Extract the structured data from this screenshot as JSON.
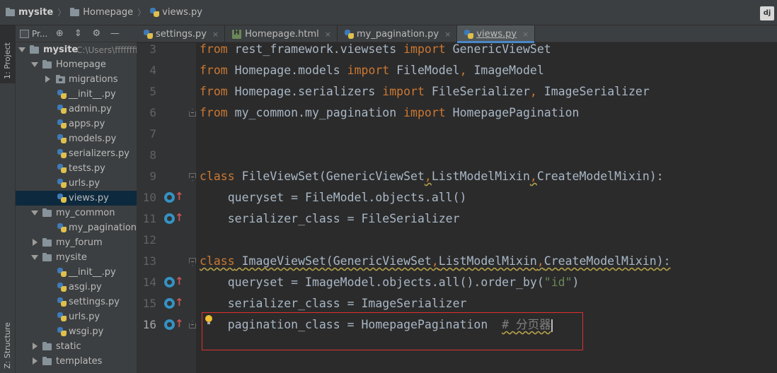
{
  "breadcrumb": {
    "project": "mysite",
    "folder": "Homepage",
    "file": "views.py"
  },
  "navbar": {
    "django_badge": "dj"
  },
  "toolstrip": {
    "project_label": "1: Project",
    "structure_label": "Z: Structure"
  },
  "panel": {
    "title": "Pr...",
    "icons": [
      "globe-icon",
      "collapse-icon",
      "gear-icon",
      "minimize-icon"
    ]
  },
  "tree": {
    "root_name": "mysite",
    "root_path": "C:\\Users\\ffffffff",
    "homepage": "Homepage",
    "migrations": "migrations",
    "homepage_files": [
      "__init__.py",
      "admin.py",
      "apps.py",
      "models.py",
      "serializers.py",
      "tests.py",
      "urls.py",
      "views.py"
    ],
    "my_common": "my_common",
    "my_common_files": [
      "my_pagination.py"
    ],
    "my_forum": "my_forum",
    "mysite": "mysite",
    "mysite_files": [
      "__init__.py",
      "asgi.py",
      "settings.py",
      "urls.py",
      "wsgi.py"
    ],
    "static": "static",
    "templates": "templates"
  },
  "tabs": [
    {
      "label": "settings.py",
      "icon": "python-icon",
      "active": false
    },
    {
      "label": "Homepage.html",
      "icon": "html-icon",
      "active": false
    },
    {
      "label": "my_pagination.py",
      "icon": "python-icon",
      "active": false
    },
    {
      "label": "views.py",
      "icon": "python-icon",
      "active": true
    }
  ],
  "tab_close": "×",
  "editor": {
    "line_numbers": [
      "3",
      "4",
      "5",
      "6",
      "7",
      "8",
      "9",
      "10",
      "11",
      "12",
      "13",
      "14",
      "15",
      "16"
    ],
    "current_line": "16",
    "lines": {
      "l3": [
        "from",
        " rest_framework.viewsets ",
        "import",
        " GenericViewSet"
      ],
      "l4": [
        "from",
        " Homepage.models ",
        "import",
        " FileModel",
        ",",
        " ImageModel"
      ],
      "l5": [
        "from",
        " Homepage.serializers ",
        "import",
        " FileSerializer",
        ",",
        " ImageSerializer"
      ],
      "l6": [
        "from",
        " my_common.my_pagination ",
        "import",
        " HomepagePagination"
      ],
      "l9": [
        "class",
        " FileViewSet(GenericViewSet",
        ",",
        "ListModelMixin",
        ",",
        "CreateModelMixin):"
      ],
      "l10": "    queryset = FileModel.objects.all()",
      "l11": "    serializer_class = FileSerializer",
      "l13": [
        "class",
        " ImageViewSet(GenericViewSet",
        ",",
        "ListModelMixin",
        ",",
        "CreateModelMixin):"
      ],
      "l14": [
        "    queryset = ImageModel.objects.all().order_by(",
        "\"id\"",
        ")"
      ],
      "l15": "    serializer_class = ImageSerializer",
      "l16": [
        "    pagination_class = HomepagePagination  ",
        "# 分页器"
      ]
    }
  },
  "colors": {
    "keyword": "#cc7832",
    "identifier": "#a9b7c6",
    "string": "#6a8759",
    "comment": "#808080",
    "highlight_box": "#e03030",
    "active_tab_underline": "#4a88c7"
  }
}
